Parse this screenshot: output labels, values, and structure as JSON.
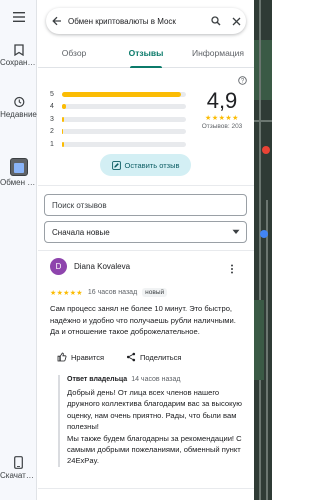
{
  "rail": {
    "items": [
      {
        "label": "Сохранено"
      },
      {
        "label": "Недавние"
      },
      {
        "label": "Обмен крипто..."
      },
      {
        "label": "Скачать прилож..."
      }
    ]
  },
  "search": {
    "query": "Обмен криптовалюты в Моск"
  },
  "tabs": [
    {
      "label": "Обзор"
    },
    {
      "label": "Отзывы"
    },
    {
      "label": "Информация"
    }
  ],
  "rating": {
    "score": "4,9",
    "stars": "★★★★★",
    "count_label": "Отзывов: 203",
    "distribution": [
      {
        "star": "5",
        "fraction": 0.96
      },
      {
        "star": "4",
        "fraction": 0.03
      },
      {
        "star": "3",
        "fraction": 0.02
      },
      {
        "star": "2",
        "fraction": 0.01
      },
      {
        "star": "1",
        "fraction": 0.02
      }
    ]
  },
  "write_review": {
    "label": "Оставить отзыв"
  },
  "review_search": {
    "placeholder": "Поиск отзывов"
  },
  "sort": {
    "label": "Сначала новые"
  },
  "review": {
    "avatar_letter": "D",
    "author": "Diana Kovaleva",
    "stars": "★★★★★",
    "time": "16 часов назад",
    "badge": "новый",
    "text": "Сам процесс занял не более 10 минут. Это быстро, надёжно и удобно что получаешь рубли наличными. Да и отношение такое доброжелательное.",
    "like_label": "Нравится",
    "share_label": "Поделиться"
  },
  "owner_reply": {
    "title": "Ответ владельца",
    "time": "14 часов назад",
    "text": "Добрый день! От лица всех членов нашего дружного коллектива благодарим вас за высокую оценку, нам очень приятно. Рады, что были вам полезны!\nМы также будем благодарны за рекомендации! С самыми добрыми пожеланиями, обменный пункт 24ExPay."
  },
  "colors": {
    "accent": "#0b7a6a",
    "star": "#fbbc04",
    "avatar": "#8e44ad",
    "button_bg": "#d3eff4"
  }
}
